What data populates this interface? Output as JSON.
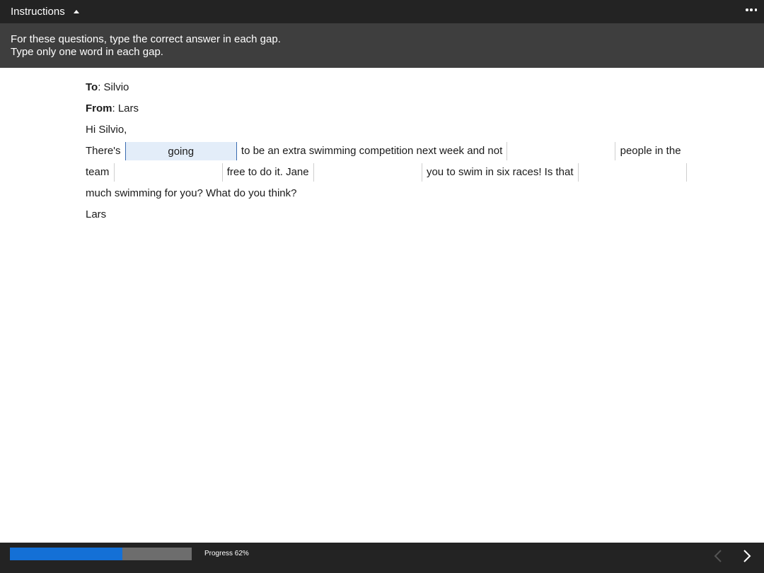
{
  "header": {
    "instructions_label": "Instructions",
    "menu_icon": "more-icon"
  },
  "instructions": {
    "line1": "For these questions, type the correct answer in each gap.",
    "line2": "Type only one word in each gap."
  },
  "email": {
    "to_label": "To",
    "to_value": ": Silvio",
    "from_label": "From",
    "from_value": ": Lars",
    "greeting": "Hi Silvio,",
    "seg1": "There's",
    "gap1_value": "going",
    "seg2": "to be an extra swimming competition next week and not",
    "gap2_value": "",
    "seg3": "people in the team",
    "gap3_value": "",
    "seg4": "free to do it. Jane",
    "gap4_value": "",
    "seg5": "you to swim in six races! Is that",
    "gap5_value": "",
    "seg6": "much swimming for you? What do you think?",
    "signoff": "Lars"
  },
  "footer": {
    "progress_label": "Progress 62%",
    "progress_value": 0.62,
    "accent_color": "#1470d6",
    "prev_icon": "chevron-left-icon",
    "next_icon": "chevron-right-icon"
  }
}
